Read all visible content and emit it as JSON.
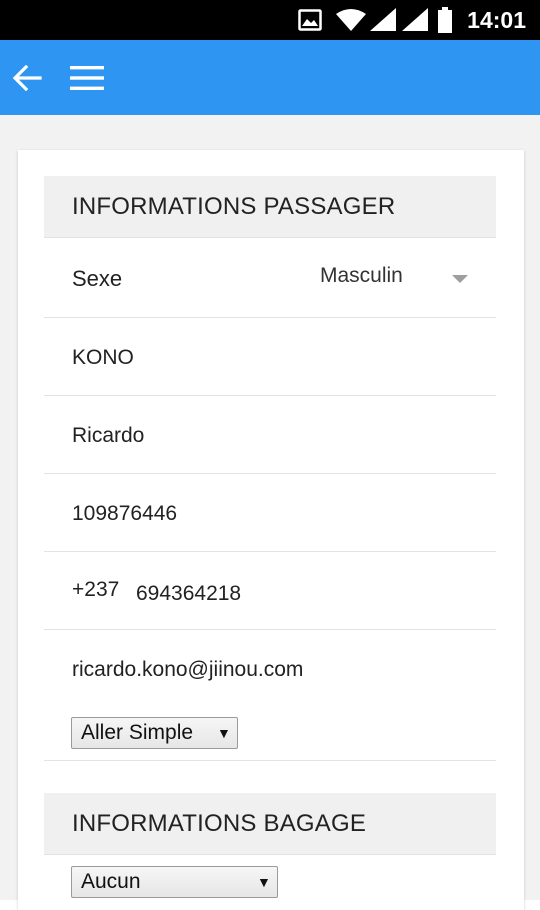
{
  "status_bar": {
    "time": "14:01",
    "icons": [
      "image-icon",
      "wifi-icon",
      "signal-icon",
      "signal-icon",
      "battery-icon"
    ]
  },
  "app_bar": {
    "back_icon": "arrow-left-icon",
    "menu_icon": "hamburger-menu-icon",
    "color": "#2e96f2"
  },
  "passenger_section": {
    "title": "INFORMATIONS PASSAGER",
    "sex_label": "Sexe",
    "sex_value": "Masculin",
    "last_name": "KONO",
    "first_name": "Ricardo",
    "id_number": "109876446",
    "phone_prefix": "+237",
    "phone_number": "694364218",
    "email": "ricardo.kono@jiinou.com",
    "trip_type": "Aller Simple"
  },
  "baggage_section": {
    "title": "INFORMATIONS BAGAGE",
    "baggage_value": "Aucun"
  },
  "select_arrow": "▼"
}
